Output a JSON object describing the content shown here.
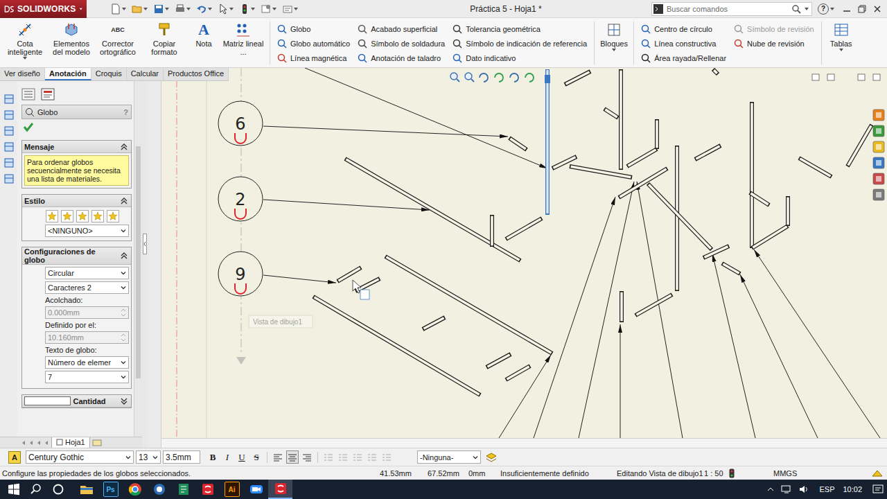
{
  "titlebar": {
    "logo": "SOLIDWORKS",
    "title": "Práctica 5 - Hoja1 *",
    "search_placeholder": "Buscar comandos",
    "help": "?"
  },
  "ribbon": [
    {
      "kind": "large",
      "label": "Cota inteligente",
      "menu": true
    },
    {
      "kind": "large",
      "label": "Elementos del modelo",
      "menu": false
    },
    {
      "kind": "large",
      "label": "Corrector ortográfico",
      "menu": false,
      "badge": "ABC"
    },
    {
      "kind": "large",
      "label": "Copiar formato",
      "menu": false
    },
    {
      "kind": "large",
      "label": "Nota",
      "menu": false,
      "badge": "A"
    },
    {
      "kind": "large",
      "label": "Matriz lineal ...",
      "menu": false
    },
    {
      "kind": "separator"
    },
    {
      "kind": "column",
      "entries": [
        {
          "label": "Globo",
          "disabled": false
        },
        {
          "label": "Globo automático",
          "disabled": false
        },
        {
          "label": "Línea magnética",
          "disabled": false
        }
      ]
    },
    {
      "kind": "column",
      "entries": [
        {
          "label": "Acabado superficial",
          "disabled": false
        },
        {
          "label": "Símbolo de soldadura",
          "disabled": false
        },
        {
          "label": "Anotación de taladro",
          "disabled": false
        }
      ]
    },
    {
      "kind": "column",
      "entries": [
        {
          "label": "Tolerancia geométrica",
          "disabled": false
        },
        {
          "label": "Símbolo de indicación de referencia",
          "disabled": false
        },
        {
          "label": "Dato indicativo",
          "disabled": false
        }
      ]
    },
    {
      "kind": "separator"
    },
    {
      "kind": "large",
      "label": "Bloques",
      "menu": true
    },
    {
      "kind": "separator"
    },
    {
      "kind": "column",
      "entries": [
        {
          "label": "Centro de círculo",
          "disabled": false
        },
        {
          "label": "Línea constructiva",
          "disabled": false
        },
        {
          "label": "Área rayada/Rellenar",
          "disabled": false
        }
      ]
    },
    {
      "kind": "column",
      "entries": [
        {
          "label": "Símbolo de revisión",
          "disabled": true
        },
        {
          "label": "Nube de revisión",
          "disabled": false
        }
      ]
    },
    {
      "kind": "separator"
    },
    {
      "kind": "large",
      "label": "Tablas",
      "menu": true
    }
  ],
  "tabs": [
    {
      "label": "Ver diseño",
      "selected": false
    },
    {
      "label": "Anotación",
      "selected": true
    },
    {
      "label": "Croquis",
      "selected": false
    },
    {
      "label": "Calcular",
      "selected": false
    },
    {
      "label": "Productos Office",
      "selected": false
    }
  ],
  "property_manager": {
    "title": "Globo",
    "help": "?",
    "message": {
      "title": "Mensaje",
      "expanded": true,
      "text": "Para ordenar globos secuencialmente se necesita una lista de materiales."
    },
    "style": {
      "title": "Estilo",
      "expanded": true,
      "value": "<NINGUNO>"
    },
    "settings": {
      "title": "Configuraciones de globo",
      "expanded": true,
      "fields": [
        {
          "kind": "select",
          "value": "Circular",
          "disabled": false
        },
        {
          "kind": "select",
          "value": "Caracteres 2",
          "disabled": false
        },
        {
          "kind": "spin",
          "label": "Acolchado:",
          "value": "0.000mm",
          "disabled": true
        },
        {
          "kind": "spin",
          "label": "Definido por el:",
          "value": "10.160mm",
          "disabled": true
        },
        {
          "kind": "select",
          "label": "Texto de globo:",
          "value": "Número de elemer",
          "disabled": false
        },
        {
          "kind": "select",
          "value": "7",
          "disabled": false
        }
      ]
    },
    "quantity": {
      "title": "Cantidad",
      "checked": false,
      "expanded": false
    }
  },
  "sheet_tabs": [
    {
      "label": "Hoja1",
      "selected": true
    }
  ],
  "canvas": {
    "balloons": [
      {
        "number": "6"
      },
      {
        "number": "2"
      },
      {
        "number": "9"
      }
    ],
    "ghost_label": "Vista de dibujo1"
  },
  "format_bar": {
    "font_icon": "A",
    "font": "Century Gothic",
    "size": "13",
    "height": "3.5mm",
    "styles": [
      {
        "label": "B",
        "on": false
      },
      {
        "label": "I",
        "on": false
      },
      {
        "label": "U",
        "on": false
      },
      {
        "label": "S",
        "on": false
      }
    ],
    "alignments": [
      {
        "selected": false
      },
      {
        "selected": true
      },
      {
        "selected": false
      }
    ],
    "layer": "-Ninguna-"
  },
  "status_bar": {
    "message": "Configure las propiedades de los globos seleccionados.",
    "x": "41.53mm",
    "y": "67.52mm",
    "z": "0mm",
    "definition": "Insuficientemente definido",
    "editing": "Editando Vista de dibujo1",
    "scale": "1 : 50",
    "units": "MMGS"
  },
  "taskbar": {
    "apps": [
      {
        "kind": "explorer",
        "active": false
      },
      {
        "kind": "photoshop",
        "label": "Ps",
        "active": false
      },
      {
        "kind": "chrome",
        "active": false
      },
      {
        "kind": "blue",
        "active": false
      },
      {
        "kind": "green",
        "active": false
      },
      {
        "kind": "solidworks",
        "active": false
      },
      {
        "kind": "illustrator",
        "label": "Ai",
        "active": false
      },
      {
        "kind": "zoom",
        "active": false
      },
      {
        "kind": "solidworks",
        "active": true
      }
    ],
    "language": "ESP",
    "time": "10:02"
  }
}
